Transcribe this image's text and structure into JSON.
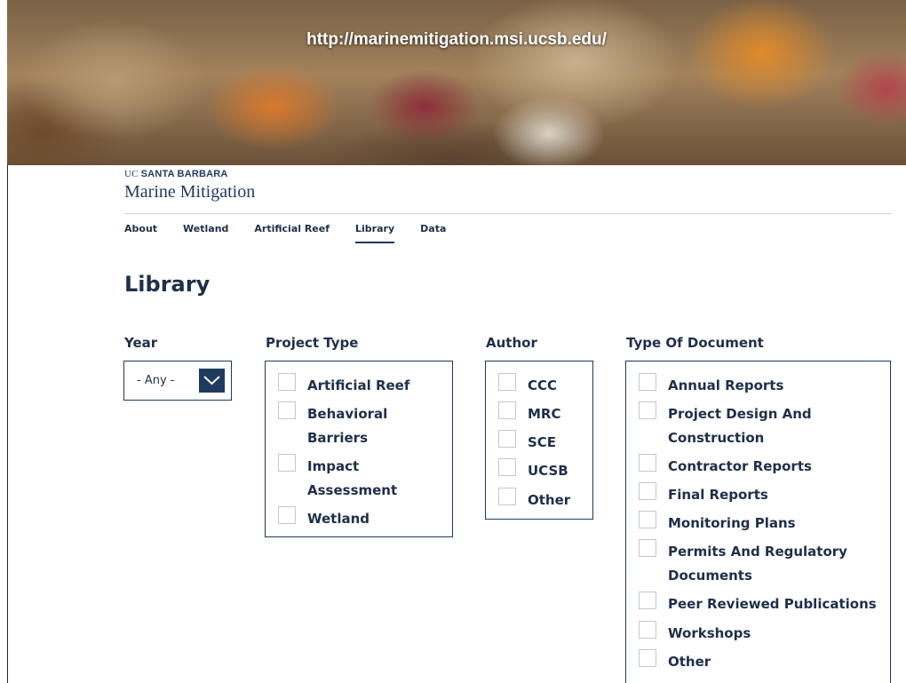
{
  "banner": {
    "url_text": "http://marinemitigation.msi.ucsb.edu/"
  },
  "header": {
    "org_prefix": "UC",
    "org_name": "SANTA BARBARA",
    "site_title": "Marine Mitigation"
  },
  "nav": {
    "items": [
      {
        "label": "About"
      },
      {
        "label": "Wetland"
      },
      {
        "label": "Artificial Reef"
      },
      {
        "label": "Library"
      },
      {
        "label": "Data"
      }
    ],
    "active": "Library"
  },
  "page": {
    "title": "Library"
  },
  "filters": {
    "year": {
      "label": "Year",
      "value": "- Any -"
    },
    "project_type": {
      "label": "Project Type",
      "options": [
        {
          "line1": "Artificial Reef",
          "line2": ""
        },
        {
          "line1": "Behavioral",
          "line2": "Barriers"
        },
        {
          "line1": "Impact",
          "line2": "Assessment"
        },
        {
          "line1": "Wetland",
          "line2": ""
        }
      ]
    },
    "author": {
      "label": "Author",
      "options": [
        {
          "line1": "CCC"
        },
        {
          "line1": "MRC"
        },
        {
          "line1": "SCE"
        },
        {
          "line1": "UCSB"
        },
        {
          "line1": "Other"
        }
      ]
    },
    "type_of_document": {
      "label": "Type Of Document",
      "options": [
        {
          "line1": "Annual Reports",
          "line2": ""
        },
        {
          "line1": "Project Design And",
          "line2": "Construction"
        },
        {
          "line1": "Contractor Reports",
          "line2": ""
        },
        {
          "line1": "Final Reports",
          "line2": ""
        },
        {
          "line1": "Monitoring Plans",
          "line2": ""
        },
        {
          "line1": "Permits And Regulatory",
          "line2": "Documents"
        },
        {
          "line1": "Peer Reviewed Publications",
          "line2": ""
        },
        {
          "line1": "Workshops",
          "line2": ""
        },
        {
          "line1": "Other",
          "line2": ""
        }
      ]
    }
  },
  "colors": {
    "navy": "#1f3a5f",
    "text": "#1f2f4a",
    "rule": "#cfd4da",
    "checkbox_border": "#c4c8cc"
  },
  "icons": {
    "year_dropdown": "chevron-down-icon"
  }
}
